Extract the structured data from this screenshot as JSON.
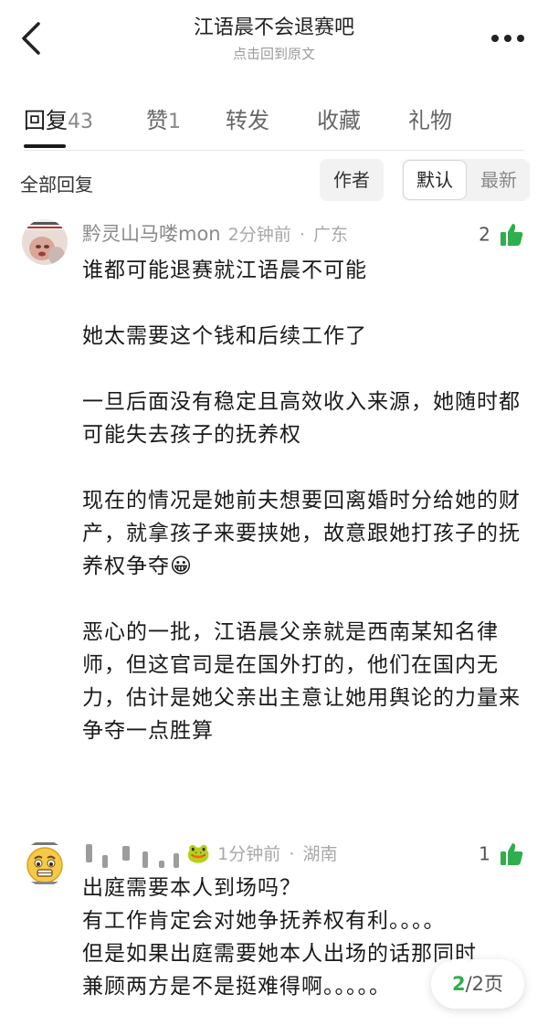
{
  "header": {
    "title": "江语晨不会退赛吧",
    "subtitle": "点击回到原文",
    "back_icon": "chevron-left-icon",
    "more_icon": "more-dots-icon"
  },
  "tabs": [
    {
      "label": "回复",
      "count": "43",
      "active": true
    },
    {
      "label": "赞",
      "count": "1",
      "active": false
    },
    {
      "label": "转发",
      "count": "",
      "active": false
    },
    {
      "label": "收藏",
      "count": "",
      "active": false
    },
    {
      "label": "礼物",
      "count": "",
      "active": false
    }
  ],
  "filter": {
    "title": "全部回复",
    "author_label": "作者",
    "sort_default": "默认",
    "sort_latest": "最新"
  },
  "comments": [
    {
      "username": "黔灵山马喽mon",
      "time": "2分钟前",
      "sep": "·",
      "location": "广东",
      "likes": "2",
      "paragraphs": [
        "谁都可能退赛就江语晨不可能",
        "她太需要这个钱和后续工作了",
        "一旦后面没有稳定且高效收入来源，她随时都可能失去孩子的抚养权",
        "现在的情况是她前夫想要回离婚时分给她的财产，就拿孩子来要挟她，故意跟她打孩子的抚养权争夺😀",
        "恶心的一批，江语晨父亲就是西南某知名律师，但这官司是在国外打的，他们在国内无力，估计是她父亲出主意让她用舆论的力量来争夺一点胜算"
      ]
    },
    {
      "username": "",
      "name_emoji": "🐸",
      "time": "1分钟前",
      "sep": "·",
      "location": "湖南",
      "likes": "1",
      "paragraphs": [
        "出庭需要本人到场吗？",
        "有工作肯定会对她争抚养权有利。。。。",
        "但是如果出庭需要她本人出场的话那同时",
        "兼顾两方是不是挺难得啊。。。。。"
      ]
    }
  ],
  "pager": {
    "current": "2",
    "rest": "/2页"
  },
  "colors": {
    "accent_green": "#2fae4e",
    "text_primary": "#1a1a1a",
    "text_meta": "#a8a8a8"
  }
}
